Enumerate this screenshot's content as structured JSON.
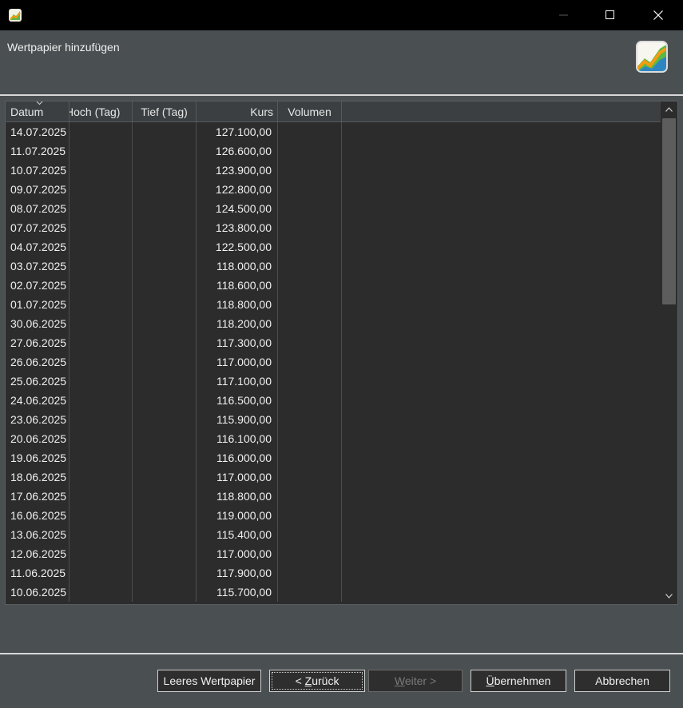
{
  "window": {
    "app_icon": "portfolio-app-icon",
    "controls": {
      "minimize_icon": "minimize-icon",
      "maximize_icon": "maximize-icon",
      "close_icon": "close-icon"
    }
  },
  "header": {
    "title": "Wertpapier hinzufügen",
    "logo_icon": "portfolio-logo-icon"
  },
  "table": {
    "sorted_column": "Datum",
    "sort_direction": "descending",
    "columns": [
      "Datum",
      "Hoch (Tag)",
      "Tief (Tag)",
      "Kurs",
      "Volumen"
    ],
    "rows": [
      {
        "datum": "14.07.2025",
        "hoch": "",
        "tief": "",
        "kurs": "127.100,00",
        "volumen": ""
      },
      {
        "datum": "11.07.2025",
        "hoch": "",
        "tief": "",
        "kurs": "126.600,00",
        "volumen": ""
      },
      {
        "datum": "10.07.2025",
        "hoch": "",
        "tief": "",
        "kurs": "123.900,00",
        "volumen": ""
      },
      {
        "datum": "09.07.2025",
        "hoch": "",
        "tief": "",
        "kurs": "122.800,00",
        "volumen": ""
      },
      {
        "datum": "08.07.2025",
        "hoch": "",
        "tief": "",
        "kurs": "124.500,00",
        "volumen": ""
      },
      {
        "datum": "07.07.2025",
        "hoch": "",
        "tief": "",
        "kurs": "123.800,00",
        "volumen": ""
      },
      {
        "datum": "04.07.2025",
        "hoch": "",
        "tief": "",
        "kurs": "122.500,00",
        "volumen": ""
      },
      {
        "datum": "03.07.2025",
        "hoch": "",
        "tief": "",
        "kurs": "118.000,00",
        "volumen": ""
      },
      {
        "datum": "02.07.2025",
        "hoch": "",
        "tief": "",
        "kurs": "118.600,00",
        "volumen": ""
      },
      {
        "datum": "01.07.2025",
        "hoch": "",
        "tief": "",
        "kurs": "118.800,00",
        "volumen": ""
      },
      {
        "datum": "30.06.2025",
        "hoch": "",
        "tief": "",
        "kurs": "118.200,00",
        "volumen": ""
      },
      {
        "datum": "27.06.2025",
        "hoch": "",
        "tief": "",
        "kurs": "117.300,00",
        "volumen": ""
      },
      {
        "datum": "26.06.2025",
        "hoch": "",
        "tief": "",
        "kurs": "117.000,00",
        "volumen": ""
      },
      {
        "datum": "25.06.2025",
        "hoch": "",
        "tief": "",
        "kurs": "117.100,00",
        "volumen": ""
      },
      {
        "datum": "24.06.2025",
        "hoch": "",
        "tief": "",
        "kurs": "116.500,00",
        "volumen": ""
      },
      {
        "datum": "23.06.2025",
        "hoch": "",
        "tief": "",
        "kurs": "115.900,00",
        "volumen": ""
      },
      {
        "datum": "20.06.2025",
        "hoch": "",
        "tief": "",
        "kurs": "116.100,00",
        "volumen": ""
      },
      {
        "datum": "19.06.2025",
        "hoch": "",
        "tief": "",
        "kurs": "116.000,00",
        "volumen": ""
      },
      {
        "datum": "18.06.2025",
        "hoch": "",
        "tief": "",
        "kurs": "117.000,00",
        "volumen": ""
      },
      {
        "datum": "17.06.2025",
        "hoch": "",
        "tief": "",
        "kurs": "118.800,00",
        "volumen": ""
      },
      {
        "datum": "16.06.2025",
        "hoch": "",
        "tief": "",
        "kurs": "119.000,00",
        "volumen": ""
      },
      {
        "datum": "13.06.2025",
        "hoch": "",
        "tief": "",
        "kurs": "115.400,00",
        "volumen": ""
      },
      {
        "datum": "12.06.2025",
        "hoch": "",
        "tief": "",
        "kurs": "117.000,00",
        "volumen": ""
      },
      {
        "datum": "11.06.2025",
        "hoch": "",
        "tief": "",
        "kurs": "117.900,00",
        "volumen": ""
      },
      {
        "datum": "10.06.2025",
        "hoch": "",
        "tief": "",
        "kurs": "115.700,00",
        "volumen": ""
      }
    ],
    "scrollbar": {
      "up_icon": "scroll-up-icon",
      "down_icon": "scroll-down-icon"
    }
  },
  "buttons": {
    "leeres_label": "Leeres Wertpapier",
    "zurueck_prefix": "< ",
    "zurueck_mnemonic": "Z",
    "zurueck_rest": "urück",
    "weiter_mnemonic": "W",
    "weiter_rest": "eiter >",
    "weiter_enabled": false,
    "uebernehmen_mnemonic": "Ü",
    "uebernehmen_rest": "bernehmen",
    "abbrechen_label": "Abbrechen"
  },
  "colors": {
    "titlebar": "#000000",
    "dialog_bg": "#4a4f52",
    "table_bg": "#2c2c2c",
    "logo_green": "#58b947",
    "logo_orange": "#f39c12",
    "logo_blue": "#2e86c1"
  }
}
